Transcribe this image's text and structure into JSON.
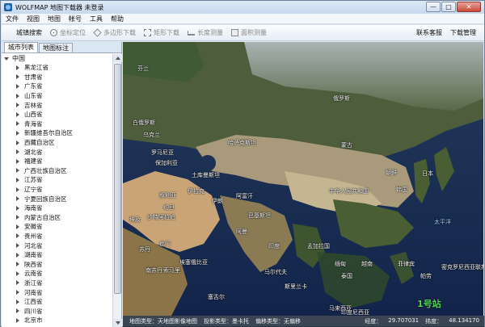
{
  "window": {
    "title": "WOLFMAP 地图下载器   未登录",
    "controls": {
      "minimize": "—",
      "maximize": "□",
      "close": "✕"
    }
  },
  "menu": [
    "文件",
    "视图",
    "地图",
    "帐号",
    "工具",
    "帮助"
  ],
  "toolbar": {
    "items": [
      {
        "label": "城镇搜索",
        "icon": "none",
        "enabled": true
      },
      {
        "label": "坐标定位",
        "icon": "crosshair-icon",
        "enabled": false
      },
      {
        "label": "多边形下载",
        "icon": "polygon-icon",
        "enabled": false
      },
      {
        "label": "矩形下载",
        "icon": "rectangle-icon",
        "enabled": false
      },
      {
        "label": "长度测量",
        "icon": "ruler-icon",
        "enabled": false
      },
      {
        "label": "面积测量",
        "icon": "area-icon",
        "enabled": false
      }
    ],
    "right": [
      "联系客服",
      "下载管理"
    ]
  },
  "panel": {
    "tabs": [
      "城市列表",
      "地图标注"
    ],
    "active_tab": 0,
    "root": "中国",
    "provinces": [
      "黑龙江省",
      "甘肃省",
      "广东省",
      "山东省",
      "吉林省",
      "山西省",
      "青海省",
      "新疆维吾尔自治区",
      "西藏自治区",
      "湖北省",
      "福建省",
      "广西壮族自治区",
      "江苏省",
      "辽宁省",
      "宁夏回族自治区",
      "海南省",
      "内蒙古自治区",
      "安徽省",
      "贵州省",
      "河北省",
      "湖南省",
      "陕西省",
      "云南省",
      "浙江省",
      "河南省",
      "江西省",
      "四川省",
      "北京市"
    ]
  },
  "map": {
    "labels": [
      "芬兰",
      "俄罗斯",
      "白俄罗斯",
      "乌克兰",
      "罗马尼亚",
      "保加利亚",
      "哈萨克斯坦",
      "蒙古",
      "土库曼斯坦",
      "伊拉克",
      "伊朗",
      "阿富汗",
      "巴基斯坦",
      "中华人民共和国",
      "朝鲜",
      "韩国",
      "日本",
      "叙利亚",
      "约旦",
      "沙特阿拉伯",
      "也门",
      "埃及",
      "苏丹",
      "埃塞俄比亚",
      "南苏丹",
      "索马里",
      "阿曼",
      "印度",
      "孟加拉国",
      "缅甸",
      "泰国",
      "越南",
      "菲律宾",
      "马来西亚",
      "马尔代夫",
      "斯里兰卡",
      "印度尼西亚",
      "密克罗尼西亚联邦",
      "太平洋",
      "帕劳",
      "塞舌尔"
    ]
  },
  "status": {
    "map_type": "地图类型：天地图影像地图",
    "projection": "投影类型：墨卡托",
    "offset": "偏移类型：无偏移",
    "lon_label": "经度：",
    "lon_value": "29.707031",
    "lat_label": "纬度：",
    "lat_value": "48.134170"
  },
  "brand": "1号站"
}
